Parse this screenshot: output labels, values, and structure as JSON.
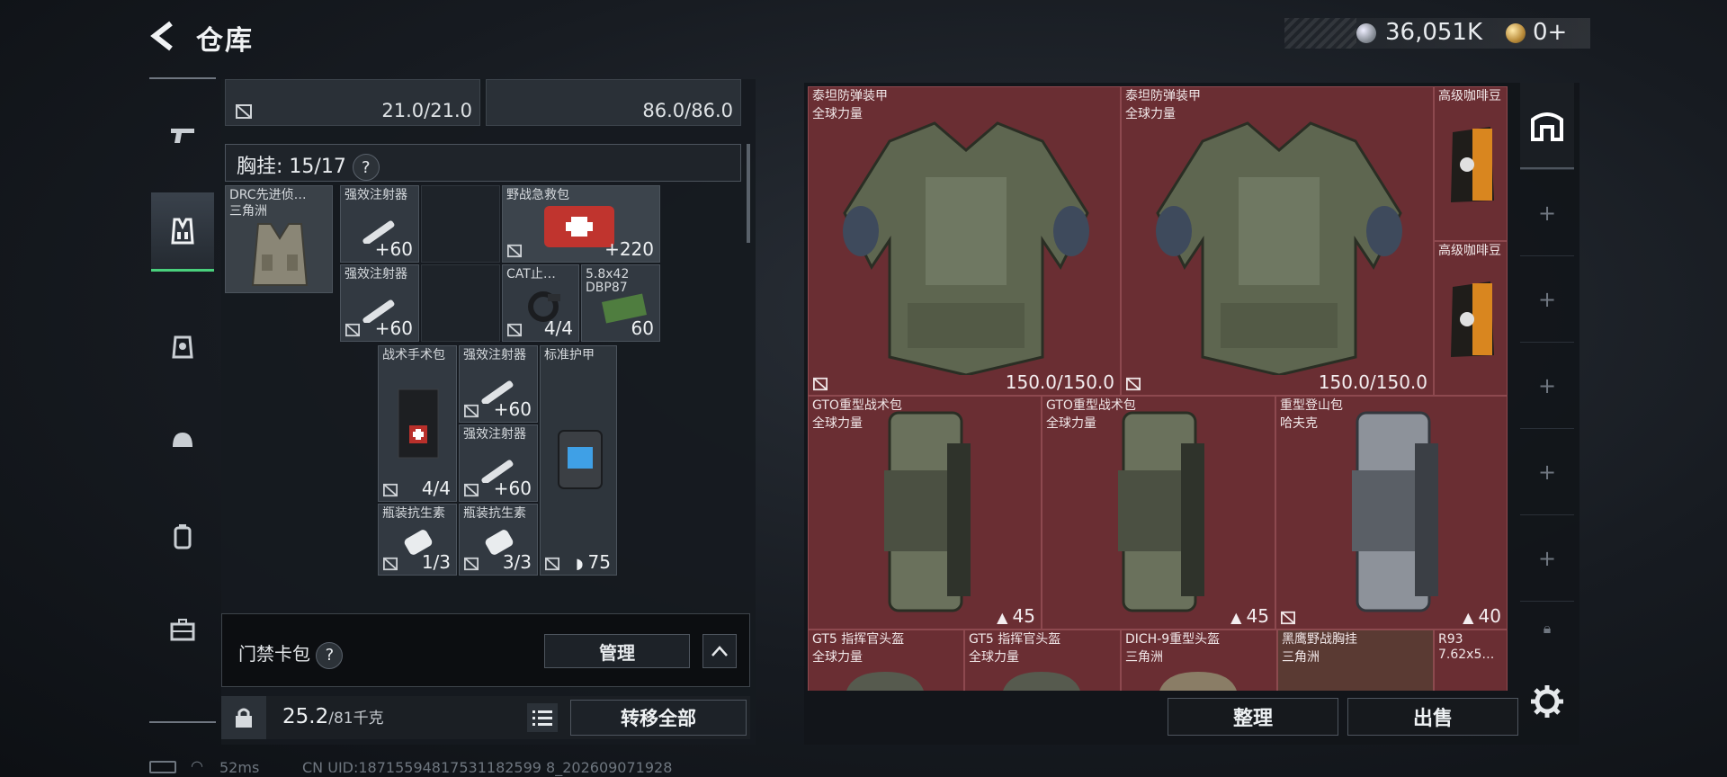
{
  "header": {
    "title": "仓库",
    "currency_silver": "36,051K",
    "currency_gold": "0+"
  },
  "left_panel": {
    "top_slots": [
      {
        "value": "21.0/21.0"
      },
      {
        "value": "86.0/86.0"
      }
    ],
    "chest_rig": {
      "label": "胸挂:",
      "count": "15/17",
      "help": "?"
    },
    "items": [
      {
        "name": "DRC先进侦…",
        "sub": "三角洲",
        "count": ""
      },
      {
        "name": "强效注射器",
        "count": "+60"
      },
      {
        "name": "强效注射器",
        "count": "+60"
      },
      {
        "name": "野战急救包",
        "count": "+220"
      },
      {
        "name": "CAT止…",
        "count": "4/4"
      },
      {
        "name": "5.8x42",
        "sub": "DBP87",
        "count": "60"
      },
      {
        "name": "战术手术包",
        "count": "4/4"
      },
      {
        "name": "强效注射器",
        "count": "+60"
      },
      {
        "name": "强效注射器",
        "count": "+60"
      },
      {
        "name": "标准护甲",
        "count": "75"
      },
      {
        "name": "瓶装抗生素",
        "count": "1/3"
      },
      {
        "name": "瓶装抗生素",
        "count": "3/3"
      }
    ],
    "keycard": {
      "label": "门禁卡包",
      "help": "?",
      "manage": "管理"
    },
    "weight": {
      "current": "25.2",
      "capacity": "/81千克"
    },
    "transfer_all": "转移全部"
  },
  "status": {
    "ping": "52ms",
    "uid": "CN UID:18715594817531182599 8_202609071928"
  },
  "stash": {
    "items": [
      {
        "name": "泰坦防弹装甲",
        "sub": "全球力量",
        "count": "150.0/150.0"
      },
      {
        "name": "泰坦防弹装甲",
        "sub": "全球力量",
        "count": "150.0/150.0"
      },
      {
        "name": "高级咖啡豆",
        "sub": "",
        "count": ""
      },
      {
        "name": "高级咖啡豆",
        "sub": "",
        "count": ""
      },
      {
        "name": "GTO重型战术包",
        "sub": "全球力量",
        "count": "45"
      },
      {
        "name": "GTO重型战术包",
        "sub": "全球力量",
        "count": "45"
      },
      {
        "name": "重型登山包",
        "sub": "哈夫克",
        "count": "40"
      },
      {
        "name": "GT5 指挥官头盔",
        "sub": "全球力量",
        "count": ""
      },
      {
        "name": "GT5 指挥官头盔",
        "sub": "全球力量",
        "count": ""
      },
      {
        "name": "DICH-9重型头盔",
        "sub": "三角洲",
        "count": ""
      },
      {
        "name": "黑鹰野战胸挂",
        "sub": "三角洲",
        "count": ""
      },
      {
        "name": "R93",
        "sub": "7.62x5…",
        "count": ""
      }
    ],
    "sort": "整理",
    "sell": "出售"
  },
  "colors": {
    "accent_green": "#49d07c",
    "stash_red": "#6a2e33"
  }
}
